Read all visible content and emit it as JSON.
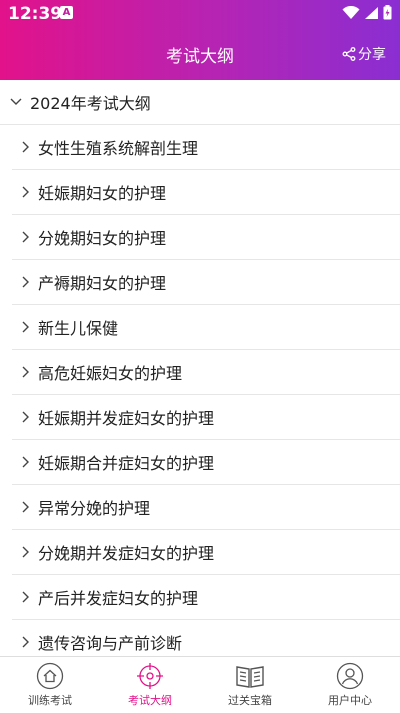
{
  "status": {
    "time": "12:39"
  },
  "header": {
    "title": "考试大纲",
    "share_label": "分享"
  },
  "section": {
    "label": "2024年考试大纲"
  },
  "items": [
    {
      "label": "女性生殖系统解剖生理"
    },
    {
      "label": "妊娠期妇女的护理"
    },
    {
      "label": "分娩期妇女的护理"
    },
    {
      "label": "产褥期妇女的护理"
    },
    {
      "label": "新生儿保健"
    },
    {
      "label": "高危妊娠妇女的护理"
    },
    {
      "label": "妊娠期并发症妇女的护理"
    },
    {
      "label": "妊娠期合并症妇女的护理"
    },
    {
      "label": "异常分娩的护理"
    },
    {
      "label": "分娩期并发症妇女的护理"
    },
    {
      "label": "产后并发症妇女的护理"
    },
    {
      "label": "遗传咨询与产前诊断"
    }
  ],
  "tabs": [
    {
      "label": "训练考试",
      "icon": "home-icon"
    },
    {
      "label": "考试大纲",
      "icon": "target-icon",
      "active": true
    },
    {
      "label": "过关宝箱",
      "icon": "book-icon"
    },
    {
      "label": "用户中心",
      "icon": "user-icon"
    }
  ],
  "colors": {
    "accent": "#e2128a",
    "gradient_end": "#8a2ed2"
  }
}
